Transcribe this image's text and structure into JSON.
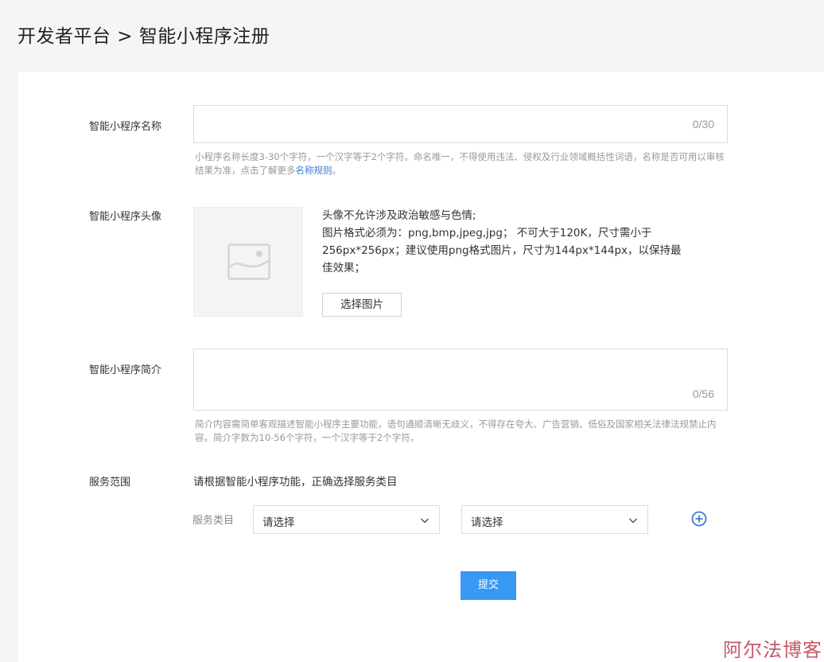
{
  "header": {
    "title": "开发者平台 > 智能小程序注册"
  },
  "form": {
    "name": {
      "label": "智能小程序名称",
      "counter": "0/30",
      "hint_text": "小程序名称长度3-30个字符，一个汉字等于2个字符。命名唯一，不得使用违法、侵权及行业领域概括性词语，名称是否可用以审核结果为准，点击了解更多",
      "hint_link": "名称规则",
      "hint_end": "。"
    },
    "avatar": {
      "label": "智能小程序头像",
      "note_line1": "头像不允许涉及政治敏感与色情;",
      "note_line2": "图片格式必须为：png,bmp,jpeg,jpg；  不可大于120K，尺寸需小于256px*256px；建议使用png格式图片，尺寸为144px*144px，以保持最佳效果；",
      "choose_button": "选择图片",
      "placeholder_icon": "image-placeholder-icon"
    },
    "intro": {
      "label": "智能小程序简介",
      "counter": "0/56",
      "hint_text": "简介内容需简单客观描述智能小程序主要功能，语句通顺清晰无歧义，不得存在夸大、广告营销、低俗及国家相关法律法规禁止内容。简介字数为10-56个字符，一个汉字等于2个字符。"
    },
    "scope": {
      "label": "服务范围",
      "description": "请根据智能小程序功能，正确选择服务类目",
      "category_label": "服务类目",
      "select1": "请选择",
      "select2": "请选择",
      "add_icon": "plus-circle-icon"
    },
    "submit_label": "提交"
  },
  "watermark": "阿尔法博客",
  "colors": {
    "primary": "#3a98f5",
    "link": "#3a7bd5",
    "hint": "#999999",
    "border": "#dcdcdc",
    "background": "#f5f5f5",
    "watermark": "#c25b6a"
  }
}
